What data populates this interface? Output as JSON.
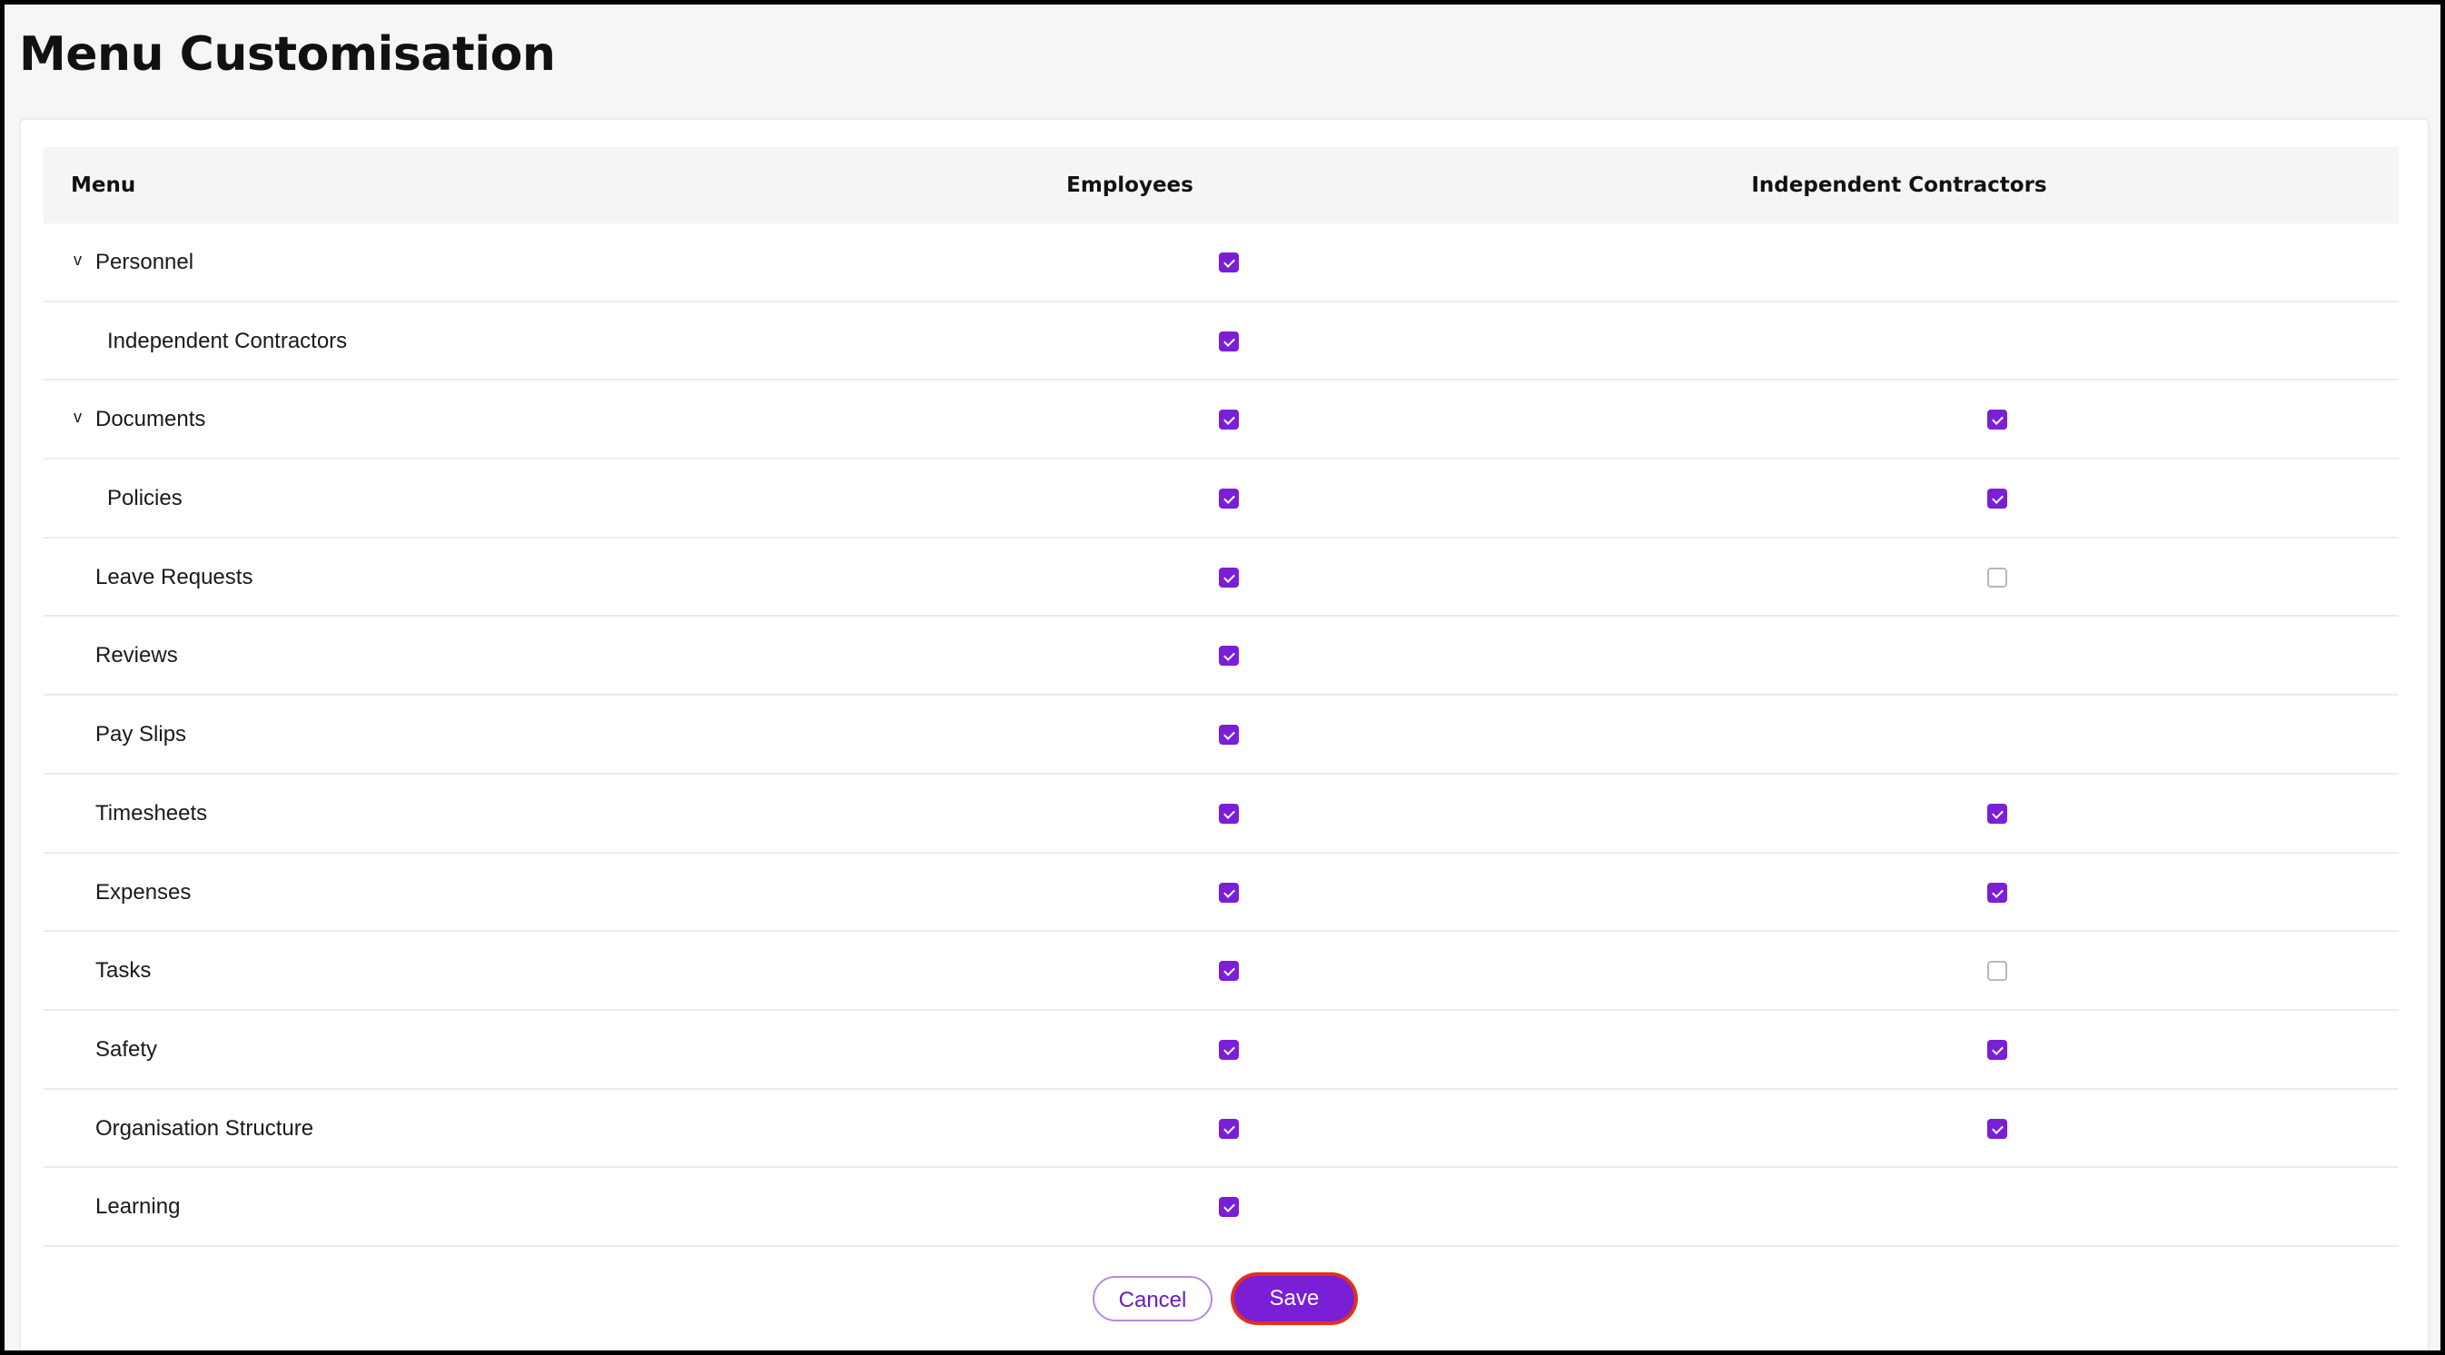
{
  "page": {
    "title": "Menu Customisation"
  },
  "table": {
    "columns": [
      "Menu",
      "Employees",
      "Independent Contractors"
    ],
    "rows": [
      {
        "label": "Personnel",
        "level": 0,
        "expander": true,
        "employees": true,
        "contractors": null
      },
      {
        "label": "Independent Contractors",
        "level": 1,
        "expander": false,
        "employees": true,
        "contractors": null
      },
      {
        "label": "Documents",
        "level": 0,
        "expander": true,
        "employees": true,
        "contractors": true
      },
      {
        "label": "Policies",
        "level": 1,
        "expander": false,
        "employees": true,
        "contractors": true
      },
      {
        "label": "Leave Requests",
        "level": 0,
        "expander": false,
        "employees": true,
        "contractors": false
      },
      {
        "label": "Reviews",
        "level": 0,
        "expander": false,
        "employees": true,
        "contractors": null
      },
      {
        "label": "Pay Slips",
        "level": 0,
        "expander": false,
        "employees": true,
        "contractors": null
      },
      {
        "label": "Timesheets",
        "level": 0,
        "expander": false,
        "employees": true,
        "contractors": true
      },
      {
        "label": "Expenses",
        "level": 0,
        "expander": false,
        "employees": true,
        "contractors": true
      },
      {
        "label": "Tasks",
        "level": 0,
        "expander": false,
        "employees": true,
        "contractors": false
      },
      {
        "label": "Safety",
        "level": 0,
        "expander": false,
        "employees": true,
        "contractors": true
      },
      {
        "label": "Organisation Structure",
        "level": 0,
        "expander": false,
        "employees": true,
        "contractors": true
      },
      {
        "label": "Learning",
        "level": 0,
        "expander": false,
        "employees": true,
        "contractors": null
      }
    ]
  },
  "actions": {
    "cancel_label": "Cancel",
    "save_label": "Save"
  },
  "icons": {
    "expander": "chevron-down-icon",
    "expander_glyph": "v"
  },
  "colors": {
    "accent": "#7a1fd6",
    "focus_ring": "#e3301c"
  }
}
